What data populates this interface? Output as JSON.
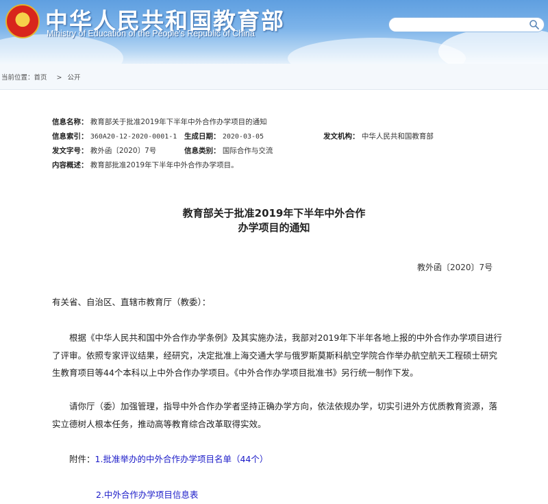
{
  "header": {
    "site_title": "中华人民共和国教育部",
    "site_subtitle": "Ministry of Education of the People's Republic of China",
    "search_placeholder": ""
  },
  "breadcrumb": {
    "prefix": "当前位置：",
    "items": [
      "首页",
      "公开"
    ],
    "separator": ">"
  },
  "meta": {
    "name_label": "信息名称：",
    "name_value": "教育部关于批准2019年下半年中外合作办学项目的通知",
    "index_label": "信息索引：",
    "index_value": "360A20-12-2020-0001-1",
    "date_label": "生成日期：",
    "date_value": "2020-03-05",
    "agency_label": "发文机构：",
    "agency_value": "中华人民共和国教育部",
    "docno_label": "发文字号：",
    "docno_value": "教外函〔2020〕7号",
    "category_label": "信息类别：",
    "category_value": "国际合作与交流",
    "summary_label": "内容概述：",
    "summary_value": "教育部批准2019年下半年中外合作办学项目。"
  },
  "document": {
    "title_line1": "教育部关于批准2019年下半年中外合作",
    "title_line2": "办学项目的通知",
    "doc_number": "教外函〔2020〕7号",
    "salutation": "有关省、自治区、直辖市教育厅（教委）：",
    "para1": "根据《中华人民共和国中外合作办学条例》及其实施办法，我部对2019年下半年各地上报的中外合作办学项目进行了评审。依照专家评议结果，经研究，决定批准上海交通大学与俄罗斯莫斯科航空学院合作举办航空航天工程硕士研究生教育项目等44个本科以上中外合作办学项目。《中外合作办学项目批准书》另行统一制作下发。",
    "para2": "请你厅（委）加强管理，指导中外合作办学者坚持正确办学方向，依法依规办学，切实引进外方优质教育资源，落实立德树人根本任务，推动高等教育综合改革取得实效。",
    "attach_label": "附件：",
    "attach1": "1.批准举办的中外合作办学项目名单（44个）",
    "attach2": "2.中外合作办学项目信息表"
  },
  "colors": {
    "header_blue": "#6aa8e6",
    "link": "#1a1ac8"
  }
}
